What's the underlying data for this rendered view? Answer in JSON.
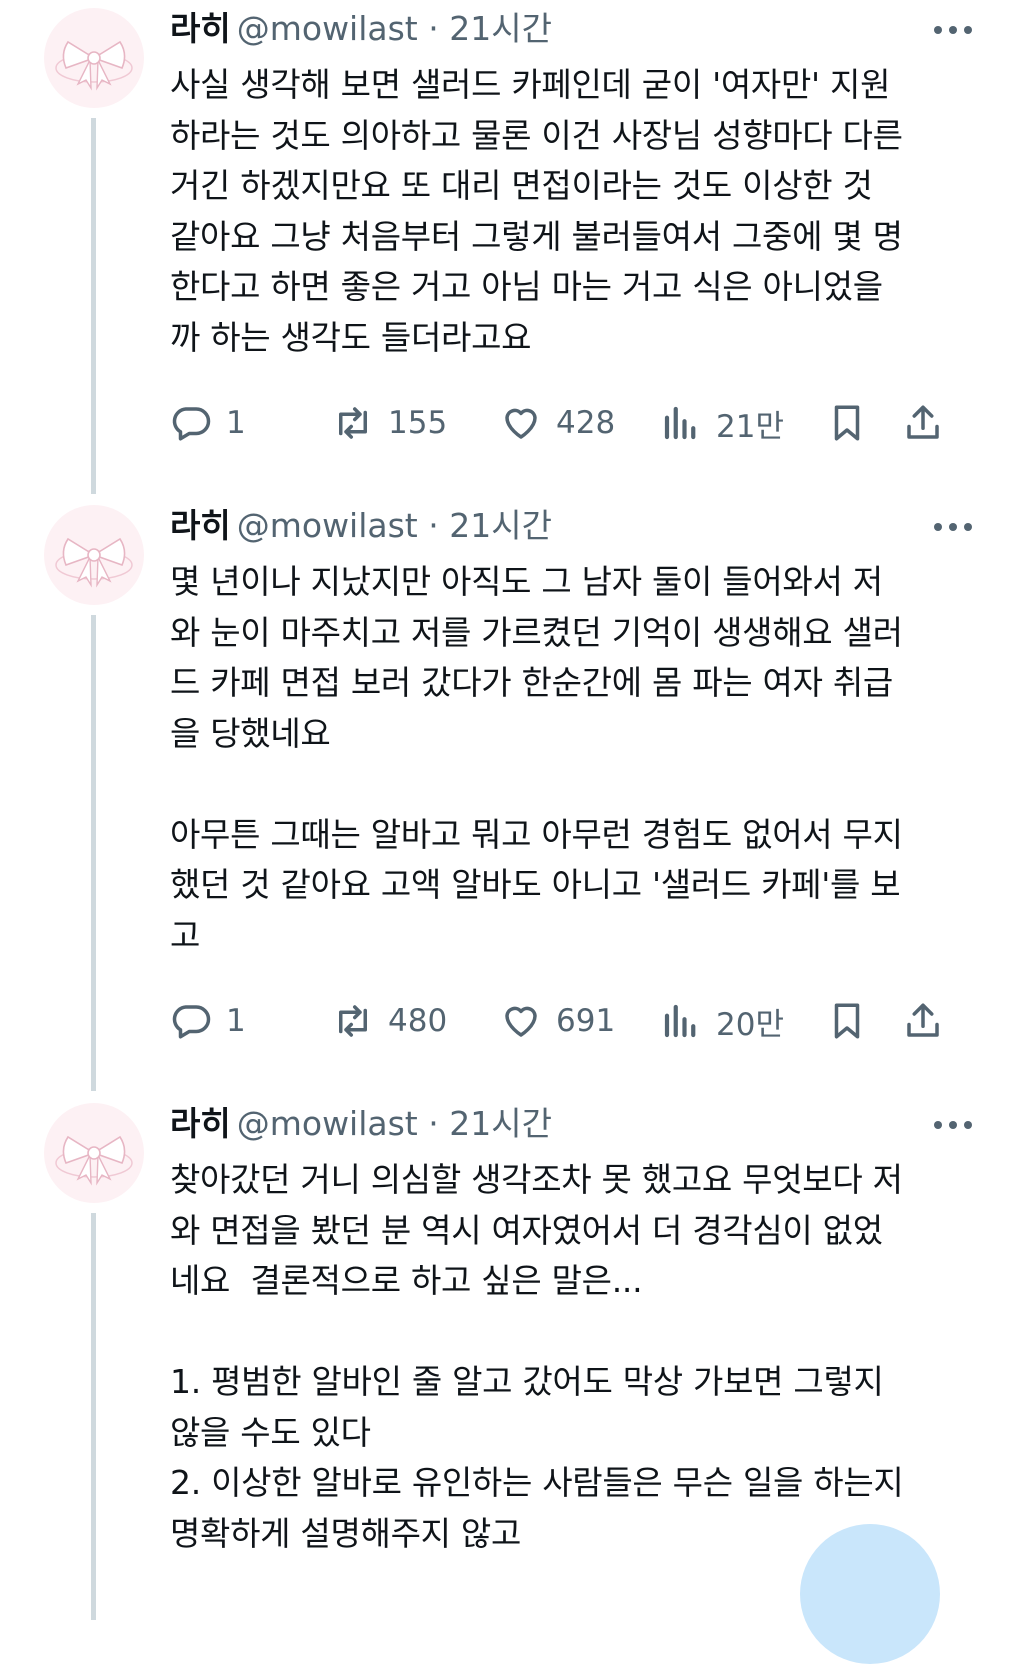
{
  "tweets": [
    {
      "name": "라히",
      "handle": "@mowilast · 21시간",
      "text": "사실 생각해 보면 샐러드 카페인데 굳이 '여자만' 지원\n하라는 것도 의아하고 물론 이건 사장님 성향마다 다른\n거긴 하겠지만요 또 대리 면접이라는 것도 이상한 것\n같아요 그냥 처음부터 그렇게 불러들여서 그중에 몇 명\n한다고 하면 좋은 거고 아님 마는 거고 식은 아니었을\n까 하는 생각도 들더라고요",
      "replies": "1",
      "retweets": "155",
      "likes": "428",
      "views": "21만"
    },
    {
      "name": "라히",
      "handle": "@mowilast · 21시간",
      "text": "몇 년이나 지났지만 아직도 그 남자 둘이 들어와서 저\n와 눈이 마주치고 저를 가르켰던 기억이 생생해요 샐러\n드 카페 면접 보러 갔다가 한순간에 몸 파는 여자 취급\n을 당했네요\n\n아무튼 그때는 알바고 뭐고 아무런 경험도 없어서 무지\n했던 것 같아요 고액 알바도 아니고 '샐러드 카페'를 보\n고",
      "replies": "1",
      "retweets": "480",
      "likes": "691",
      "views": "20만"
    },
    {
      "name": "라히",
      "handle": "@mowilast · 21시간",
      "text": "찾아갔던 거니 의심할 생각조차 못 했고요 무엇보다 저\n와 면접을 봤던 분 역시 여자였어서 더 경각심이 없었\n네요  결론적으로 하고 싶은 말은...\n\n1. 평범한 알바인 줄 알고 갔어도 막상 가보면 그렇지\n않을 수도 있다\n2. 이상한 알바로 유인하는 사람들은 무슨 일을 하는지\n명확하게 설명해주지 않고"
    }
  ],
  "icons": [
    "bow-avatar",
    "more-icon",
    "reply-icon",
    "retweet-icon",
    "like-icon",
    "views-icon",
    "bookmark-icon",
    "share-icon"
  ],
  "colors": {
    "text": "#0f1419",
    "secondary": "#536471",
    "thread": "#cfd9de",
    "avatar_bg": "#fdf1f4",
    "fab": "#c9e6fb"
  }
}
